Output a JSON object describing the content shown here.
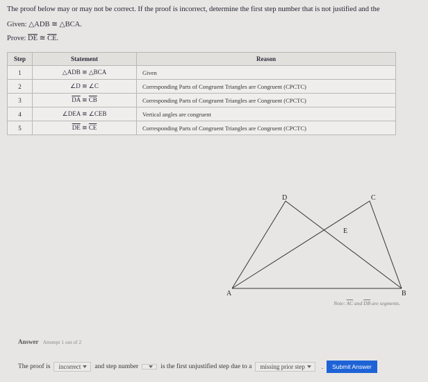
{
  "intro": "The proof below may or may not be correct. If the proof is incorrect, determine the first step number that is not justified and the",
  "given_label": "Given:",
  "given_math": "△ADB ≅ △BCA.",
  "prove_label": "Prove:",
  "prove_math_de": "DE",
  "prove_math_cong": " ≅ ",
  "prove_math_ce": "CE",
  "prove_math_period": ".",
  "table": {
    "headers": {
      "step": "Step",
      "statement": "Statement",
      "reason": "Reason"
    },
    "rows": [
      {
        "step": "1",
        "statement_html": "△ADB ≅ △BCA",
        "reason": "Given"
      },
      {
        "step": "2",
        "statement_html": "∠D ≅ ∠C",
        "reason": "Corresponding Parts of Congruent Triangles are Congruent (CPCTC)"
      },
      {
        "step": "3",
        "statement_html": "DA ≅ CB",
        "statement_overline": true,
        "reason": "Corresponding Parts of Congruent Triangles are Congruent (CPCTC)"
      },
      {
        "step": "4",
        "statement_html": "∠DEA ≅ ∠CEB",
        "reason": "Vertical angles are congruent"
      },
      {
        "step": "5",
        "statement_html": "DE ≅ CE",
        "statement_overline": true,
        "reason": "Corresponding Parts of Congruent Triangles are Congruent (CPCTC)"
      }
    ]
  },
  "figure": {
    "labels": {
      "A": "A",
      "B": "B",
      "C": "C",
      "D": "D",
      "E": "E"
    },
    "note_prefix": "Note: ",
    "note_ac": "AC",
    "note_and": " and ",
    "note_db": "DB",
    "note_suffix": " are segments."
  },
  "answer_block": {
    "label": "Answer",
    "attempt": "Attempt 1 out of 2",
    "sentence_p1": "The proof is",
    "dd1": "incorrect",
    "sentence_p2": "and step number",
    "dd2": " ",
    "sentence_p3": "is the first unjustified step due to a",
    "dd3": "missing prior step",
    "submit": "Submit Answer"
  }
}
